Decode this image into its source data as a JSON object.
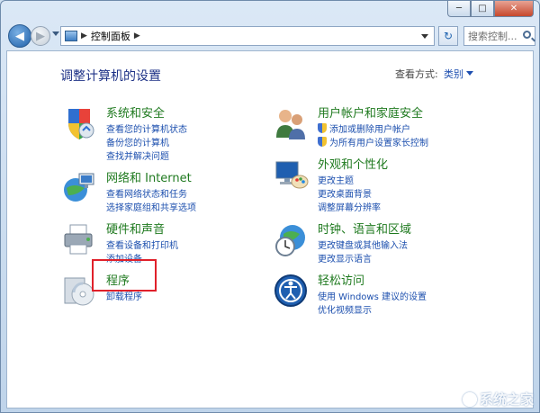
{
  "window": {
    "min_label": "─",
    "max_label": "□",
    "close_label": "✕"
  },
  "nav": {
    "back_glyph": "◀",
    "fwd_glyph": "▶",
    "breadcrumb": "控制面板",
    "sep": "▶",
    "refresh_glyph": "↻",
    "search_placeholder": "搜索控制..."
  },
  "header": {
    "title": "调整计算机的设置",
    "viewby_label": "查看方式:",
    "viewby_value": "类别"
  },
  "categories": [
    {
      "title": "系统和安全",
      "links": [
        "查看您的计算机状态",
        "备份您的计算机",
        "查找并解决问题"
      ]
    },
    {
      "title": "网络和 Internet",
      "links": [
        "查看网络状态和任务",
        "选择家庭组和共享选项"
      ]
    },
    {
      "title": "硬件和声音",
      "links": [
        "查看设备和打印机",
        "添加设备"
      ]
    },
    {
      "title": "程序",
      "links": [
        "卸载程序"
      ]
    },
    {
      "title": "用户帐户和家庭安全",
      "links": [
        "添加或删除用户帐户",
        "为所有用户设置家长控制"
      ]
    },
    {
      "title": "外观和个性化",
      "links": [
        "更改主题",
        "更改桌面背景",
        "调整屏幕分辨率"
      ]
    },
    {
      "title": "时钟、语言和区域",
      "links": [
        "更改键盘或其他输入法",
        "更改显示语言"
      ]
    },
    {
      "title": "轻松访问",
      "links": [
        "使用 Windows 建议的设置",
        "优化视频显示"
      ]
    }
  ],
  "watermark": "系统之家",
  "colors": {
    "category_title": "#1f7a1f",
    "link": "#1c4fae",
    "highlight": "#e0202a"
  }
}
